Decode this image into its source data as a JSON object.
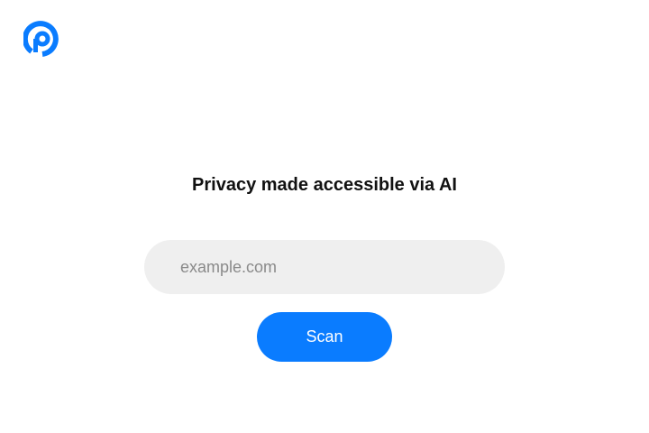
{
  "brand": {
    "logo_icon": "p-logo-icon",
    "accent_color": "#0a7cff"
  },
  "main": {
    "headline": "Privacy made accessible via AI",
    "search": {
      "placeholder": "example.com",
      "value": ""
    },
    "scan_label": "Scan"
  }
}
